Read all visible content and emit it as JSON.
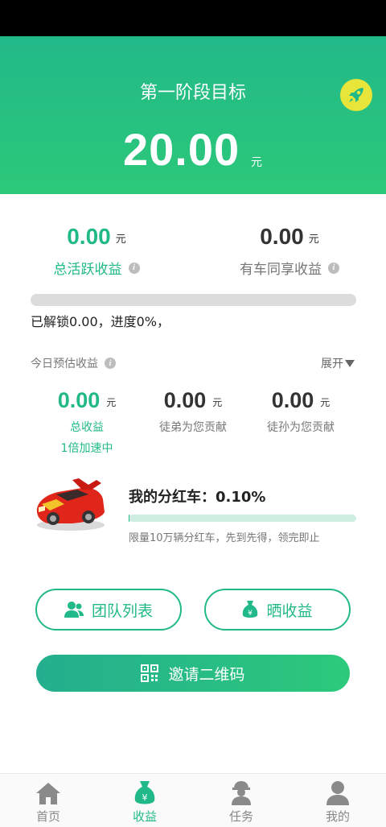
{
  "header": {
    "stage_title": "第一阶段目标",
    "amount": "20.00",
    "unit": "元",
    "rocket_icon": "rocket-icon"
  },
  "earnings": [
    {
      "value": "0.00",
      "unit": "元",
      "label": "总活跃收益",
      "value_color": "#22b989",
      "label_color": "#22b989"
    },
    {
      "value": "0.00",
      "unit": "元",
      "label": "有车同享收益",
      "value_color": "#333333",
      "label_color": "#777777"
    }
  ],
  "progress": {
    "percent": 0,
    "text": "已解锁0.00，进度0%，"
  },
  "today": {
    "title": "今日预估收益",
    "expand_label": "展开",
    "stats": [
      {
        "value": "0.00",
        "unit": "元",
        "label": "总收益",
        "sub": "1倍加速中"
      },
      {
        "value": "0.00",
        "unit": "元",
        "label": "徒弟为您贡献"
      },
      {
        "value": "0.00",
        "unit": "元",
        "label": "徒孙为您贡献"
      }
    ]
  },
  "dividend_car": {
    "title": "我的分红车：0.10%",
    "percent": 0.1,
    "note": "限量10万辆分红车，先到先得，领完即止"
  },
  "buttons": {
    "team_list": "团队列表",
    "share_earnings": "晒收益",
    "invite_qr": "邀请二维码"
  },
  "tabs": [
    {
      "label": "首页",
      "icon": "home-icon",
      "active": false
    },
    {
      "label": "收益",
      "icon": "money-bag-icon",
      "active": true
    },
    {
      "label": "任务",
      "icon": "worker-icon",
      "active": false
    },
    {
      "label": "我的",
      "icon": "user-icon",
      "active": false
    }
  ],
  "colors": {
    "accent": "#22b989",
    "accent_light": "#2cc879",
    "rocket_bg": "#e7e43a"
  }
}
